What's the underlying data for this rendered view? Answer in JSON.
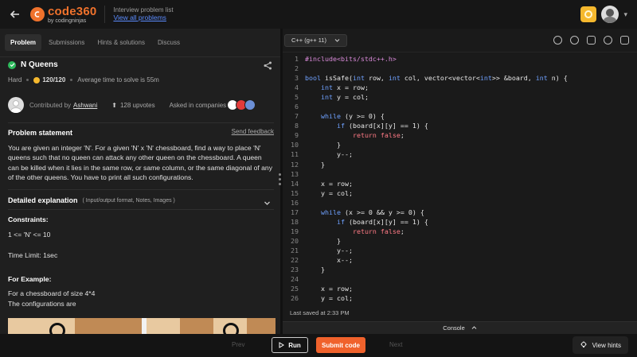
{
  "header": {
    "logo_main": "code360",
    "logo_sub": "by codingninjas",
    "breadcrumb_title": "Interview problem list",
    "breadcrumb_link": "View all problems"
  },
  "tabs": [
    "Problem",
    "Submissions",
    "Hints & solutions",
    "Discuss"
  ],
  "problem": {
    "title": "N Queens",
    "difficulty": "Hard",
    "points": "120/120",
    "avg_time": "Average time to solve is 55m",
    "contributed_by": "Contributed by",
    "contributor": "Ashwani",
    "upvotes": "128 upvotes",
    "asked_in": "Asked in companies",
    "statement_title": "Problem statement",
    "send_feedback": "Send feedback",
    "statement": "You are given an integer 'N'. For a given 'N' x 'N' chessboard, find a way to place 'N' queens such that no queen can attack any other queen on the chessboard. A queen can be killed when it lies in the same row, or same column, or the same diagonal of any of the other queens. You have to print all such configurations.",
    "detailed_title": "Detailed explanation",
    "detailed_sub": "( Input/output format, Notes, Images )",
    "constraints_title": "Constraints:",
    "constraint_1": "1 <= 'N' <= 10",
    "time_limit": "Time Limit: 1sec",
    "example_title": "For Example:",
    "example_line1": "For a chessboard of size 4*4",
    "example_line2": "The configurations are"
  },
  "editor": {
    "language": "C++ (g++ 11)",
    "last_saved": "Last saved at 2:33 PM",
    "console_label": "Console",
    "lines": [
      [
        [
          "pp",
          "#include<bits/stdc++.h>"
        ]
      ],
      [],
      [
        [
          "kw",
          "bool"
        ],
        [
          "",
          " isSafe("
        ],
        [
          "kw",
          "int"
        ],
        [
          "",
          " row, "
        ],
        [
          "kw",
          "int"
        ],
        [
          "",
          " col, vector<vector<"
        ],
        [
          "kw",
          "int"
        ],
        [
          "",
          ">> &board, "
        ],
        [
          "kw",
          "int"
        ],
        [
          "",
          " n) {"
        ]
      ],
      [
        [
          "",
          "    "
        ],
        [
          "kw",
          "int"
        ],
        [
          "",
          " x = row;"
        ]
      ],
      [
        [
          "",
          "    "
        ],
        [
          "kw",
          "int"
        ],
        [
          "",
          " y = col;"
        ]
      ],
      [],
      [
        [
          "",
          "    "
        ],
        [
          "kw",
          "while"
        ],
        [
          "",
          " (y >= 0) {"
        ]
      ],
      [
        [
          "",
          "        "
        ],
        [
          "kw",
          "if"
        ],
        [
          "",
          " (board[x][y] == 1) {"
        ]
      ],
      [
        [
          "",
          "            "
        ],
        [
          "ret",
          "return false"
        ],
        [
          "",
          ";"
        ]
      ],
      [
        [
          "",
          "        }"
        ]
      ],
      [
        [
          "",
          "        y--;"
        ]
      ],
      [
        [
          "",
          "    }"
        ]
      ],
      [],
      [
        [
          "",
          "    x = row;"
        ]
      ],
      [
        [
          "",
          "    y = col;"
        ]
      ],
      [],
      [
        [
          "",
          "    "
        ],
        [
          "kw",
          "while"
        ],
        [
          "",
          " (x >= 0 && y >= 0) {"
        ]
      ],
      [
        [
          "",
          "        "
        ],
        [
          "kw",
          "if"
        ],
        [
          "",
          " (board[x][y] == 1) {"
        ]
      ],
      [
        [
          "",
          "            "
        ],
        [
          "ret",
          "return false"
        ],
        [
          "",
          ";"
        ]
      ],
      [
        [
          "",
          "        }"
        ]
      ],
      [
        [
          "",
          "        y--;"
        ]
      ],
      [
        [
          "",
          "        x--;"
        ]
      ],
      [
        [
          "",
          "    }"
        ]
      ],
      [],
      [
        [
          "",
          "    x = row;"
        ]
      ],
      [
        [
          "",
          "    y = col;"
        ]
      ]
    ]
  },
  "footer": {
    "prev": "Prev",
    "run": "Run",
    "submit": "Submit code",
    "next": "Next",
    "hints": "View hints"
  },
  "colors": {
    "accent": "#f0622c",
    "link": "#5b8cff",
    "keyword": "#6fa1ff",
    "return": "#ff7a85",
    "success": "#2dbb5c"
  }
}
